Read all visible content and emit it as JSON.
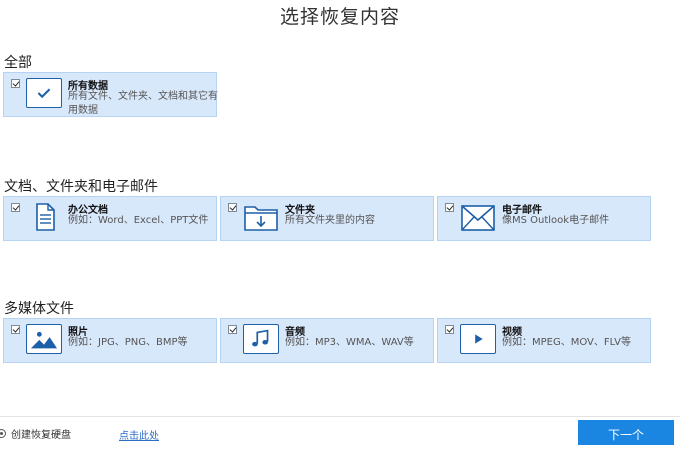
{
  "title": "选择恢复内容",
  "sections": [
    {
      "title": "全部",
      "items": [
        {
          "name": "所有数据",
          "desc": "所有文件、文件夹、文档和其它有用数据",
          "icon": "checkmark-icon",
          "checked": true
        }
      ]
    },
    {
      "title": "文档、文件夹和电子邮件",
      "items": [
        {
          "name": "办公文档",
          "desc": "例如：Word、Excel、PPT文件",
          "icon": "document-icon",
          "checked": true
        },
        {
          "name": "文件夹",
          "desc": "所有文件夹里的内容",
          "icon": "folder-icon",
          "checked": true
        },
        {
          "name": "电子邮件",
          "desc": "像MS Outlook电子邮件",
          "icon": "envelope-icon",
          "checked": true
        }
      ]
    },
    {
      "title": "多媒体文件",
      "items": [
        {
          "name": "照片",
          "desc": "例如：JPG、PNG、BMP等",
          "icon": "image-icon",
          "checked": true
        },
        {
          "name": "音频",
          "desc": "例如：MP3、WMA、WAV等",
          "icon": "music-note-icon",
          "checked": true
        },
        {
          "name": "视频",
          "desc": "例如：MPEG、MOV、FLV等",
          "icon": "play-icon",
          "checked": true
        }
      ]
    }
  ],
  "footer": {
    "create_disk_label": "创建恢复硬盘",
    "link_label": "点击此处",
    "next_label": "下一个"
  },
  "colors": {
    "card_bg": "#d8e8fb",
    "card_border": "#b7d3f4",
    "icon_blue": "#1d5fa8",
    "button_blue": "#1a86e2"
  }
}
